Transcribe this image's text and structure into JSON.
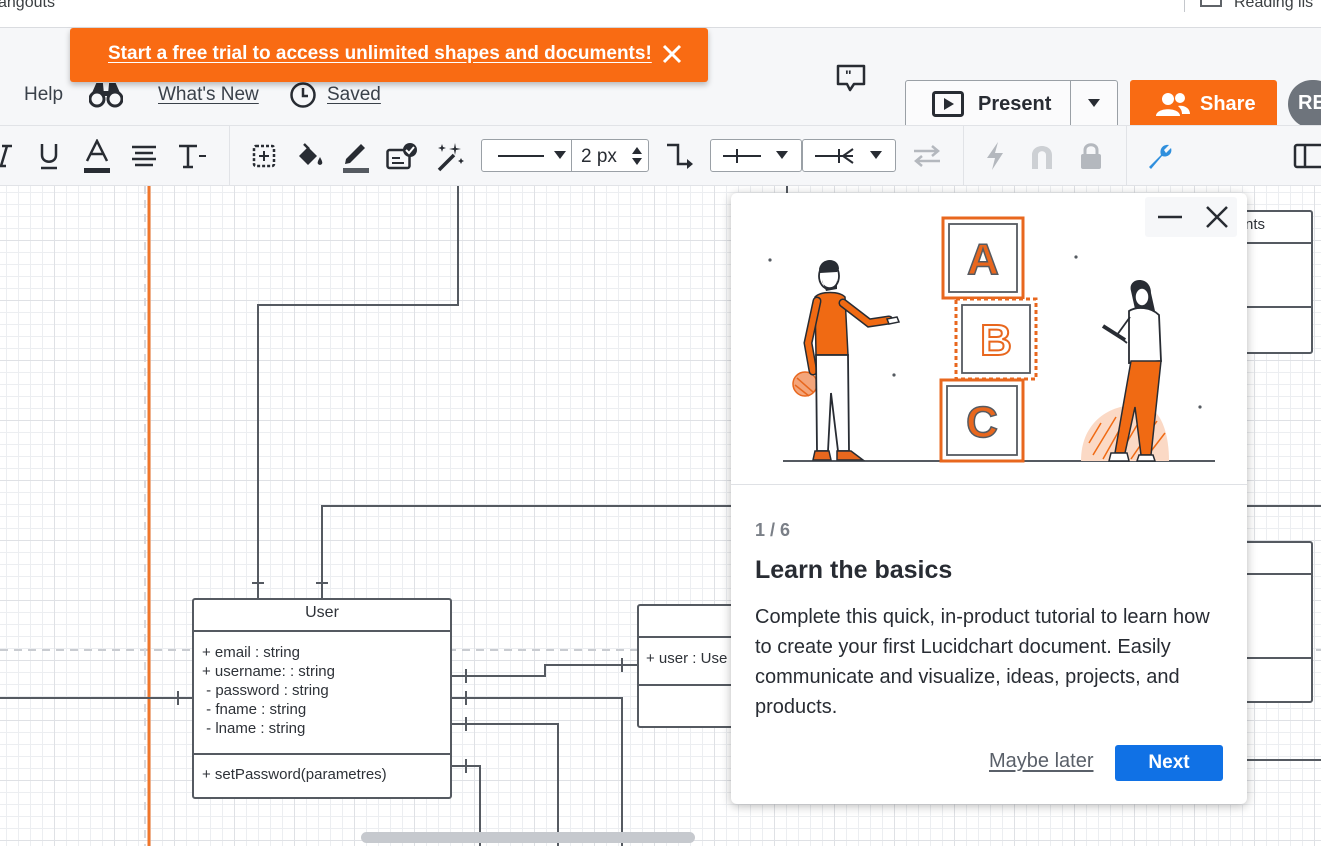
{
  "bookmarks": {
    "left_item": "angouts",
    "right_item": "Reading lis"
  },
  "header": {
    "help": "Help",
    "whats_new": "What's New",
    "saved": "Saved",
    "present": "Present",
    "share": "Share",
    "avatar_initials": "RE",
    "brand_color": "#f96b13",
    "icons": [
      "binoculars-icon",
      "clock-icon",
      "comment-icon",
      "present-icon",
      "users-icon"
    ]
  },
  "banner": {
    "text": "Start a free trial to access unlimited shapes and documents!"
  },
  "toolbar": {
    "line_width": "2 px",
    "icons": [
      "italic-icon",
      "underline-icon",
      "text-color-icon",
      "align-icon",
      "text-options-icon",
      "shape-border-icon",
      "fill-icon",
      "line-color-icon",
      "style-icon",
      "magic-icon",
      "line-style-icon",
      "connector-icon",
      "arrow-start-icon",
      "arrow-end-icon",
      "swap-icon",
      "lightning-icon",
      "magnet-icon",
      "lock-icon",
      "wrench-icon",
      "panel-icon"
    ]
  },
  "diagram": {
    "user_class": {
      "name": "User",
      "attributes": [
        "+ email : string",
        "+ username: : string",
        " - password : string",
        " - fname : string",
        " - lname : string"
      ],
      "methods": [
        "+ setPassword(parametres)"
      ]
    },
    "partial_class_text": "+ user : Use",
    "partial_top_right_text": "nts"
  },
  "tutorial": {
    "step": "1 / 6",
    "title": "Learn the basics",
    "body": "Complete this quick, in-product tutorial to learn how to create your first Lucidchart document. Easily communicate and visualize, ideas, projects, and products.",
    "maybe_later": "Maybe later",
    "next": "Next",
    "blocks": [
      "A",
      "B",
      "C"
    ]
  }
}
